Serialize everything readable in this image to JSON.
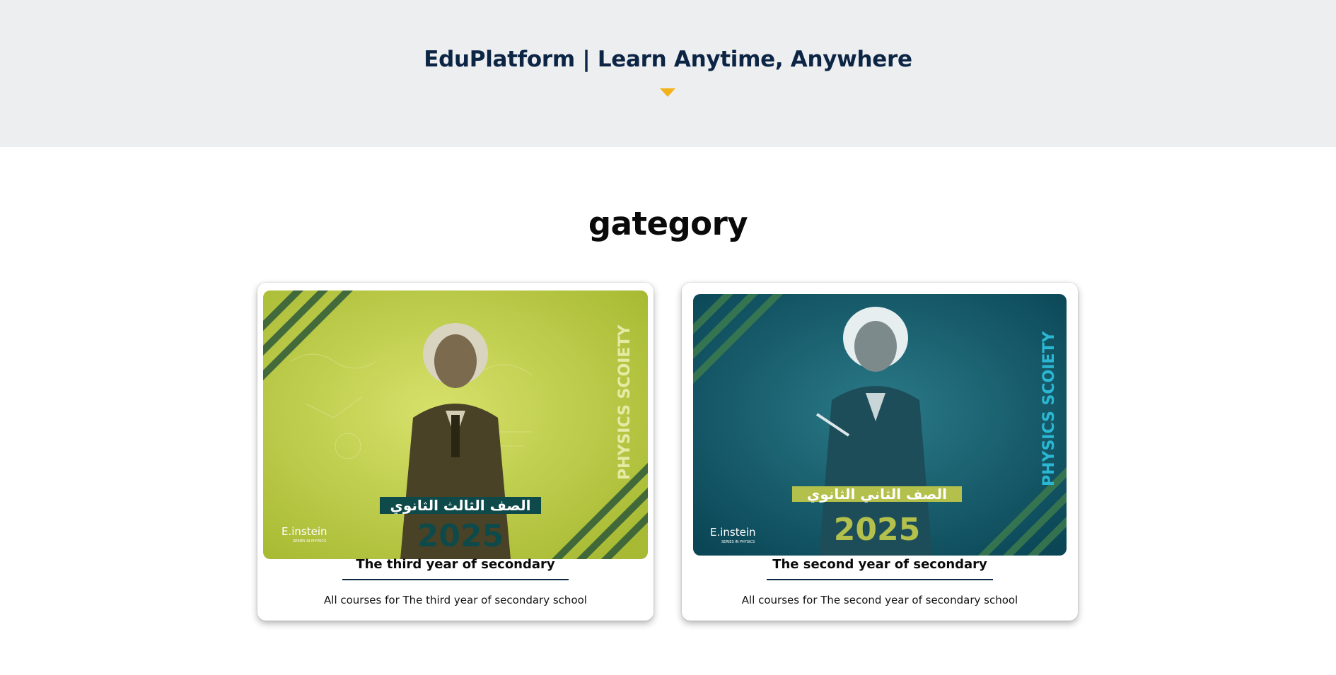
{
  "hero": {
    "title": "EduPlatform | Learn Anytime, Anywhere",
    "caret_icon": "caret-down-icon",
    "caret_color": "#f4b21a",
    "background": "#edeef0",
    "title_color": "#0c2545"
  },
  "section": {
    "title": "gategory"
  },
  "cards": [
    {
      "title": "The third year of secondary",
      "description": "All courses for The third year of secondary school",
      "image": {
        "banner_text": "الصف الثالث الثانوي",
        "year": "2025",
        "side_text": "PHYSICS SCOIETY",
        "logo_text": "E.instein",
        "logo_sub": "SERIES IN PHYSICS",
        "theme_color": "#bccb4a"
      }
    },
    {
      "title": "The second year of secondary",
      "description": "All courses for The second year of secondary school",
      "image": {
        "banner_text": "الصف الثاني الثانوي",
        "year": "2025",
        "side_text": "PHYSICS SCOIETY",
        "logo_text": "E.instein",
        "logo_sub": "SERIES IN PHYSICS",
        "theme_color": "#0e5667"
      }
    }
  ]
}
